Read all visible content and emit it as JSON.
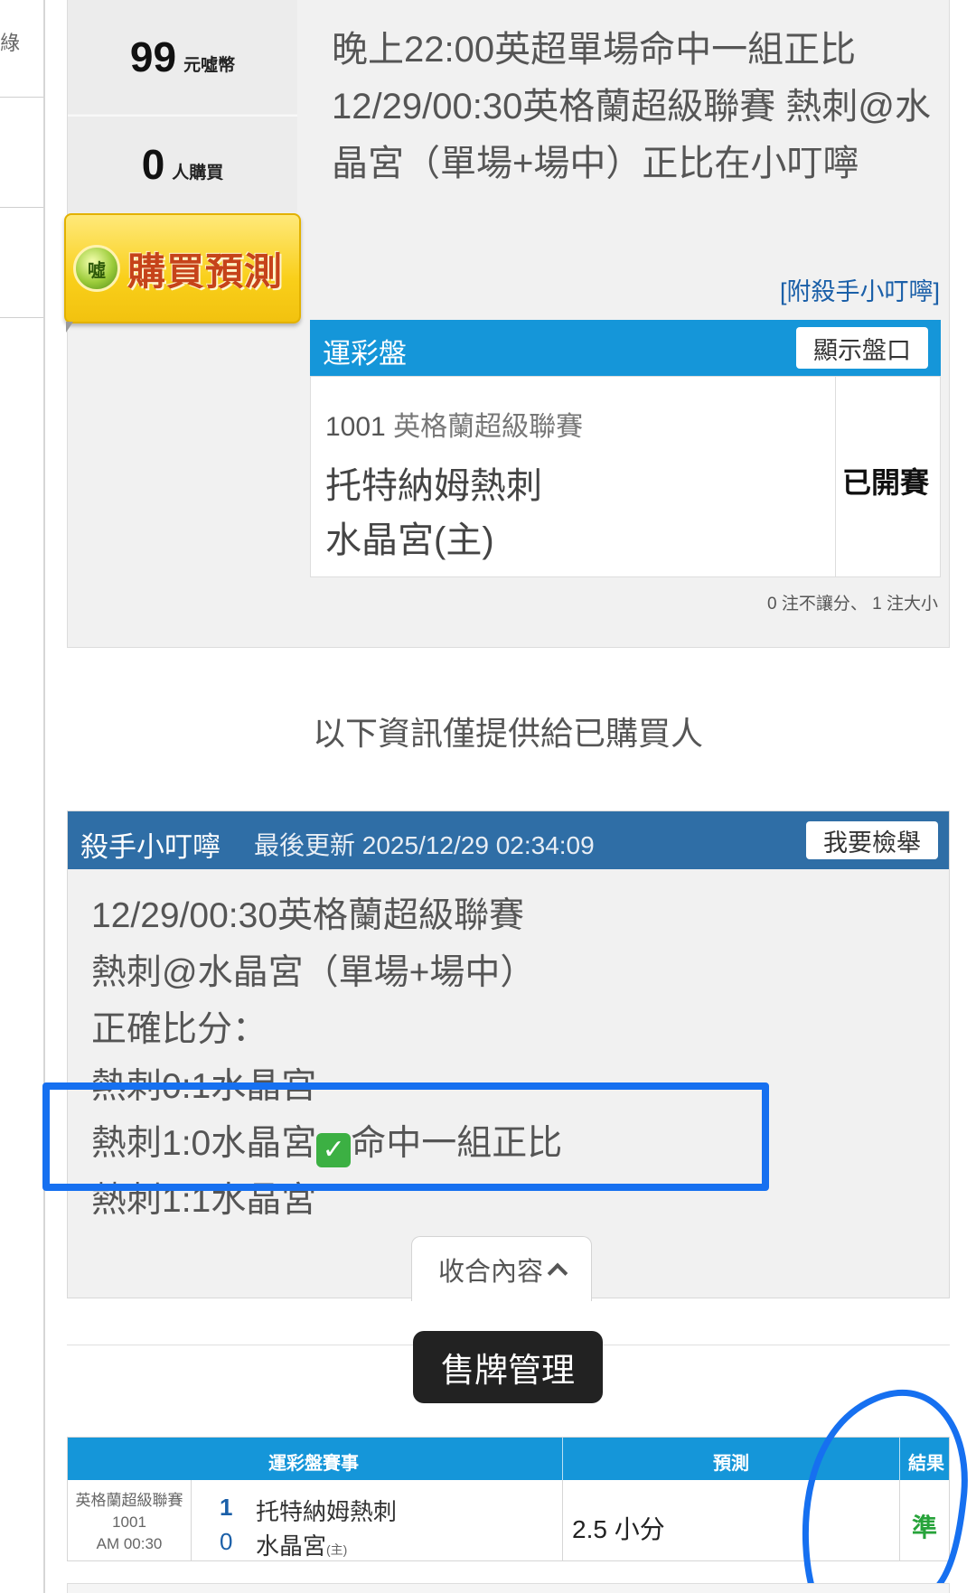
{
  "sidebar": {
    "glyph": "綠"
  },
  "stats": {
    "price_value": "99",
    "price_unit": "元噓幣",
    "buyers_value": "0",
    "buyers_unit": "人購買"
  },
  "buy_button": {
    "coin_text": "噓",
    "label": "購買預測"
  },
  "title": "晚上22:00英超單場命中一組正比 12/29/00:30英格蘭超級聯賽 熱刺@水晶宮（單場+場中）正比在小叮嚀",
  "attach_link": "[附殺手小叮嚀]",
  "odds": {
    "header_label": "運彩盤",
    "show_button": "顯示盤口",
    "game_no": "1001",
    "league": "英格蘭超級聯賽",
    "team_away": "托特納姆熱刺",
    "team_home": "水晶宮(主)",
    "status": "已開賽",
    "bet_note": "0 注不讓分、 1 注大小"
  },
  "notice": "以下資訊僅提供給已購買人",
  "killer": {
    "name": "殺手小叮嚀",
    "updated": "最後更新 2025/12/29 02:34:09",
    "report_button": "我要檢舉",
    "lines": [
      "12/29/00:30英格蘭超級聯賽",
      "熱刺@水晶宮（單場+場中）",
      "正確比分：",
      "熱刺0:1水晶宮",
      "熱刺1:0水晶宮",
      "命中一組正比",
      "熱刺1:1水晶宮"
    ],
    "collapse_label": "收合內容"
  },
  "sell_button": "售牌管理",
  "results_table": {
    "headers": [
      "運彩盤賽事",
      "預測",
      "結果"
    ],
    "row": {
      "league": "英格蘭超級聯賽",
      "game_no": "1001",
      "time": "AM 00:30",
      "score_away": "1",
      "score_home": "0",
      "team_away": "托特納姆熱刺",
      "team_home": "水晶宮",
      "home_mark": "(主)",
      "prediction": "2.5 小分",
      "result": "準"
    }
  },
  "colors": {
    "odds_header": "#1596d9",
    "killer_header": "#2f6ea6",
    "highlight": "#1670f0",
    "result_green": "#27a33a",
    "buy_button": "#f9cf1a"
  }
}
